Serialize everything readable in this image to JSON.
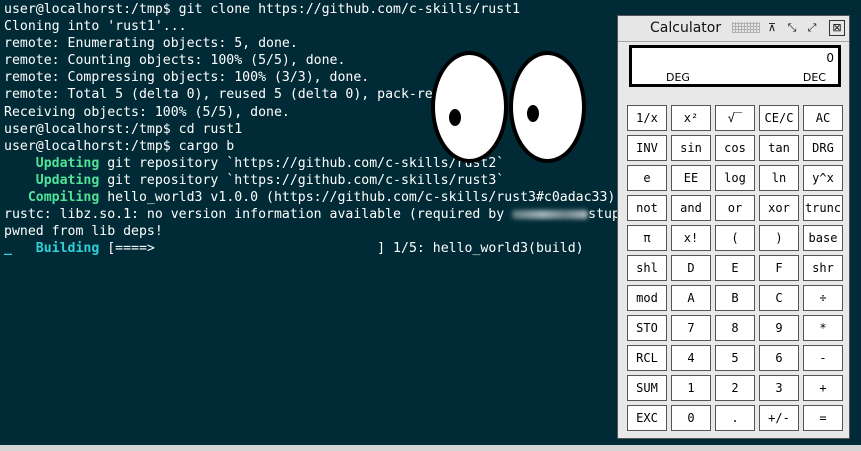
{
  "terminal": {
    "lines": [
      {
        "text": "user@localhorst:/tmp$ git clone https://github.com/c-skills/rust1"
      },
      {
        "text": "Cloning into 'rust1'..."
      },
      {
        "text": "remote: Enumerating objects: 5, done."
      },
      {
        "text": "remote: Counting objects: 100% (5/5), done."
      },
      {
        "text": "remote: Compressing objects: 100% (3/3), done."
      },
      {
        "text": "remote: Total 5 (delta 0), reused 5 (delta 0), pack-reused 0"
      },
      {
        "text": "Receiving objects: 100% (5/5), done."
      },
      {
        "text": "user@localhorst:/tmp$ cd rust1"
      },
      {
        "text": "user@localhorst:/tmp$ cargo b"
      },
      {
        "prefix": "    Updating",
        "text": " git repository `https://github.com/c-skills/rust2`"
      },
      {
        "prefix": "    Updating",
        "text": " git repository `https://github.com/c-skills/rust3`"
      },
      {
        "prefix": "   Compiling",
        "text": " hello_world3 v1.0.0 (https://github.com/c-skills/rust3#c0adac33)"
      },
      {
        "text": "rustc: libz.so.1: no version information available (required by ",
        "redacted": true,
        "suffix": "stup) in"
      },
      {
        "text": "pwned from lib deps!"
      },
      {
        "cursor": "_",
        "prefix": "   Building",
        "text": " [====>                            ] 1/5: hello_world3(build)"
      }
    ]
  },
  "calculator": {
    "title": "Calculator",
    "titlebar_buttons": [
      "⊼",
      "⤡",
      "⤢",
      "⊠"
    ],
    "display": {
      "value": "0",
      "angle_mode": "DEG",
      "base_mode": "DEC"
    },
    "keys": [
      "1/x",
      "x²",
      "√‾",
      "CE/C",
      "AC",
      "INV",
      "sin",
      "cos",
      "tan",
      "DRG",
      "e",
      "EE",
      "log",
      "ln",
      "y^x",
      "not",
      "and",
      "or",
      "xor",
      "trunc",
      "π",
      "x!",
      "(",
      ")",
      "base",
      "shl",
      "D",
      "E",
      "F",
      "shr",
      "mod",
      "A",
      "B",
      "C",
      "÷",
      "STO",
      "7",
      "8",
      "9",
      "*",
      "RCL",
      "4",
      "5",
      "6",
      "-",
      "SUM",
      "1",
      "2",
      "3",
      "+",
      "EXC",
      "0",
      ".",
      "+/-",
      "="
    ]
  },
  "colors": {
    "terminal_bg": "#002b36",
    "terminal_fg": "#ffffff",
    "cargo_green": "#4fe39a",
    "cargo_cyan": "#2fd0d8"
  }
}
